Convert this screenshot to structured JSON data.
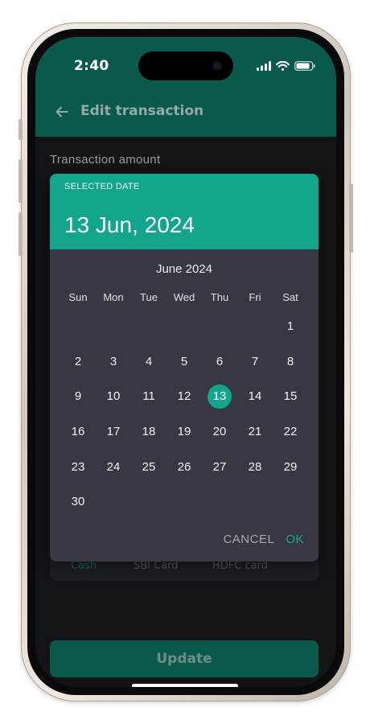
{
  "status_bar": {
    "time": "2:40"
  },
  "header": {
    "title": "Edit transaction"
  },
  "form": {
    "amount_label": "Transaction amount"
  },
  "accounts_tabs": [
    "Cash",
    "SBI Card",
    "HDFC card"
  ],
  "date_picker": {
    "selected_label": "SELECTED DATE",
    "selected_date": "13 Jun, 2024",
    "month_label": "June 2024",
    "weekdays": [
      "Sun",
      "Mon",
      "Tue",
      "Wed",
      "Thu",
      "Fri",
      "Sat"
    ],
    "first_weekday_index": 6,
    "days_in_month": 30,
    "selected_day": 13,
    "cancel_label": "CANCEL",
    "ok_label": "OK"
  },
  "update_button": {
    "label": "Update"
  },
  "colors": {
    "primary": "#0a5a4c",
    "accent": "#12a68d",
    "background": "#141418",
    "picker": "#373841"
  }
}
